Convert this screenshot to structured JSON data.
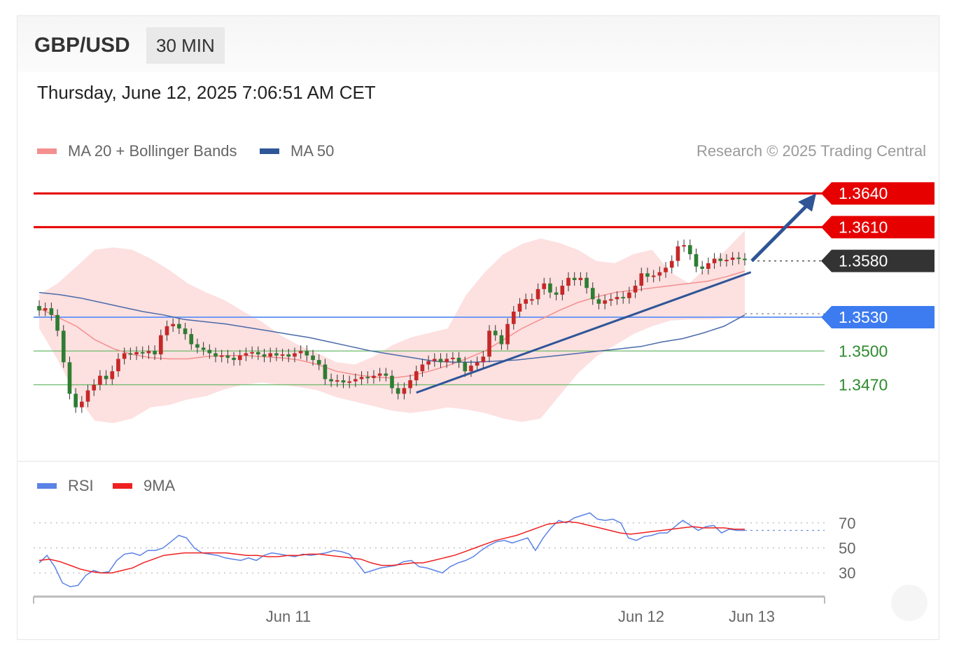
{
  "header": {
    "pair": "GBP/USD",
    "timeframe": "30 MIN"
  },
  "date": "Thursday, June 12, 2025 7:06:51 AM CET",
  "legend": {
    "items": [
      {
        "label": "MA 20 + Bollinger Bands",
        "color": "#f48f8f"
      },
      {
        "label": "MA 50",
        "color": "#2f5797"
      }
    ],
    "credit": "Research © 2025 Trading Central"
  },
  "rsi_legend": {
    "items": [
      {
        "label": "RSI",
        "color": "#5b82e6"
      },
      {
        "label": "9MA",
        "color": "#ef2020"
      }
    ]
  },
  "colors": {
    "up": "#2e7d32",
    "down": "#c62828",
    "resistance": "#e60000",
    "support": "#3d7bf0",
    "current": "#333333",
    "trend": "#2f5597"
  },
  "chart_data": [
    {
      "type": "candlestick",
      "ylim": [
        1.3405,
        1.3665
      ],
      "x_ticks": [
        "Jun 11",
        "Jun 12",
        "Jun 13"
      ],
      "levels": [
        {
          "value": 1.364,
          "label": "1.3640",
          "kind": "resistance"
        },
        {
          "value": 1.361,
          "label": "1.3610",
          "kind": "resistance"
        },
        {
          "value": 1.358,
          "label": "1.3580",
          "kind": "current"
        },
        {
          "value": 1.353,
          "label": "1.3530",
          "kind": "pivot"
        },
        {
          "value": 1.35,
          "label": "1.3500",
          "kind": "support"
        },
        {
          "value": 1.347,
          "label": "1.3470",
          "kind": "support"
        }
      ],
      "close": [
        1.3536,
        1.3538,
        1.3532,
        1.3518,
        1.349,
        1.3462,
        1.345,
        1.3455,
        1.3465,
        1.347,
        1.3478,
        1.3475,
        1.3482,
        1.3493,
        1.3498,
        1.3497,
        1.3499,
        1.3498,
        1.35,
        1.3497,
        1.3514,
        1.3522,
        1.3524,
        1.352,
        1.3515,
        1.3506,
        1.3503,
        1.3501,
        1.3498,
        1.3495,
        1.3496,
        1.3494,
        1.3492,
        1.3496,
        1.3498,
        1.3499,
        1.3497,
        1.3495,
        1.3498,
        1.3496,
        1.3497,
        1.3495,
        1.3498,
        1.35,
        1.3496,
        1.3492,
        1.3488,
        1.3475,
        1.3473,
        1.3474,
        1.3472,
        1.3473,
        1.3475,
        1.3477,
        1.3476,
        1.3478,
        1.348,
        1.3478,
        1.3467,
        1.3462,
        1.3467,
        1.3474,
        1.3482,
        1.3488,
        1.3491,
        1.3493,
        1.349,
        1.3493,
        1.3494,
        1.349,
        1.3482,
        1.3487,
        1.349,
        1.3495,
        1.3518,
        1.3514,
        1.3506,
        1.3524,
        1.3535,
        1.3542,
        1.3546,
        1.3546,
        1.3555,
        1.356,
        1.3552,
        1.355,
        1.3558,
        1.3565,
        1.3563,
        1.3565,
        1.3556,
        1.3546,
        1.3542,
        1.3545,
        1.3546,
        1.3548,
        1.3547,
        1.3552,
        1.3558,
        1.3569,
        1.3566,
        1.3567,
        1.357,
        1.3574,
        1.358,
        1.3593,
        1.3594,
        1.3586,
        1.3575,
        1.3573,
        1.3578,
        1.3582,
        1.358,
        1.3581,
        1.3583,
        1.3582,
        1.3581
      ],
      "upper_band": [
        1.355,
        1.356,
        1.3575,
        1.359,
        1.3592,
        1.359,
        1.3582,
        1.3572,
        1.356,
        1.3552,
        1.3545,
        1.3535,
        1.3526,
        1.3514,
        1.3505,
        1.3498,
        1.349,
        1.3488,
        1.3495,
        1.3505,
        1.3512,
        1.3516,
        1.352,
        1.355,
        1.357,
        1.3586,
        1.3595,
        1.36,
        1.3596,
        1.359,
        1.358,
        1.3578,
        1.3586,
        1.359,
        1.357,
        1.356,
        1.3575,
        1.359,
        1.3607
      ],
      "lower_band": [
        1.352,
        1.3492,
        1.346,
        1.3438,
        1.3436,
        1.344,
        1.345,
        1.3452,
        1.3457,
        1.346,
        1.3466,
        1.347,
        1.3472,
        1.347,
        1.3468,
        1.3465,
        1.3459,
        1.3455,
        1.3451,
        1.3447,
        1.3445,
        1.3447,
        1.345,
        1.3448,
        1.3445,
        1.344,
        1.3437,
        1.344,
        1.346,
        1.348,
        1.3495,
        1.3505,
        1.3515,
        1.3522,
        1.3527,
        1.3528,
        1.3528,
        1.3529,
        1.3529
      ],
      "ma20": [
        1.3538,
        1.353,
        1.3522,
        1.351,
        1.3502,
        1.3497,
        1.3494,
        1.3493,
        1.3493,
        1.3495,
        1.3496,
        1.3496,
        1.3495,
        1.3494,
        1.3492,
        1.3488,
        1.3482,
        1.3479,
        1.3477,
        1.3476,
        1.3478,
        1.3482,
        1.3487,
        1.3493,
        1.35,
        1.351,
        1.352,
        1.3528,
        1.3536,
        1.3543,
        1.3548,
        1.3552,
        1.3554,
        1.3556,
        1.3558,
        1.356,
        1.3562,
        1.3566,
        1.3571
      ],
      "ma50": [
        1.3552,
        1.355,
        1.3547,
        1.3543,
        1.3539,
        1.3535,
        1.3532,
        1.3528,
        1.3526,
        1.3524,
        1.3521,
        1.3518,
        1.3515,
        1.3512,
        1.3508,
        1.3504,
        1.35,
        1.3497,
        1.3494,
        1.3491,
        1.349,
        1.349,
        1.3491,
        1.3492,
        1.3494,
        1.3496,
        1.3498,
        1.35,
        1.3502,
        1.3504,
        1.3508,
        1.3511,
        1.3516,
        1.3522,
        1.3532
      ],
      "trendline": {
        "from_index": 62,
        "from_value": 1.3463,
        "to_index": 117,
        "to_value": 1.357
      },
      "projection": {
        "from_value": 1.358,
        "to_value": 1.364
      }
    },
    {
      "type": "line",
      "title": "RSI",
      "ylim": [
        15,
        85
      ],
      "y_ticks": [
        70,
        50,
        30
      ],
      "series": [
        {
          "name": "RSI",
          "values": [
            38,
            44,
            35,
            22,
            19,
            20,
            28,
            32,
            30,
            31,
            40,
            45,
            46,
            44,
            48,
            48,
            50,
            55,
            60,
            58,
            50,
            46,
            45,
            44,
            42,
            41,
            40,
            42,
            40,
            44,
            46,
            45,
            44,
            43,
            45,
            44,
            45,
            46,
            48,
            47,
            45,
            38,
            30,
            32,
            34,
            35,
            36,
            39,
            40,
            35,
            34,
            32,
            30,
            35,
            38,
            40,
            43,
            48,
            52,
            55,
            56,
            54,
            56,
            58,
            48,
            58,
            66,
            72,
            70,
            74,
            76,
            78,
            73,
            72,
            73,
            70,
            58,
            56,
            59,
            60,
            62,
            62,
            67,
            72,
            68,
            64,
            67,
            68,
            62,
            65,
            64,
            64
          ]
        },
        {
          "name": "9MA",
          "values": [
            40,
            41,
            39,
            36,
            33,
            31,
            30,
            30,
            32,
            34,
            38,
            41,
            44,
            45,
            46,
            46,
            46,
            46,
            46,
            45,
            44,
            44,
            43,
            43,
            44,
            44,
            45,
            45,
            44,
            43,
            42,
            41,
            38,
            36,
            36,
            37,
            38,
            38,
            40,
            42,
            44,
            47,
            50,
            53,
            56,
            58,
            60,
            63,
            66,
            69,
            70,
            71,
            70,
            68,
            66,
            64,
            62,
            61,
            62,
            63,
            64,
            65,
            66,
            67,
            66,
            66,
            66,
            65,
            65
          ]
        }
      ]
    }
  ]
}
